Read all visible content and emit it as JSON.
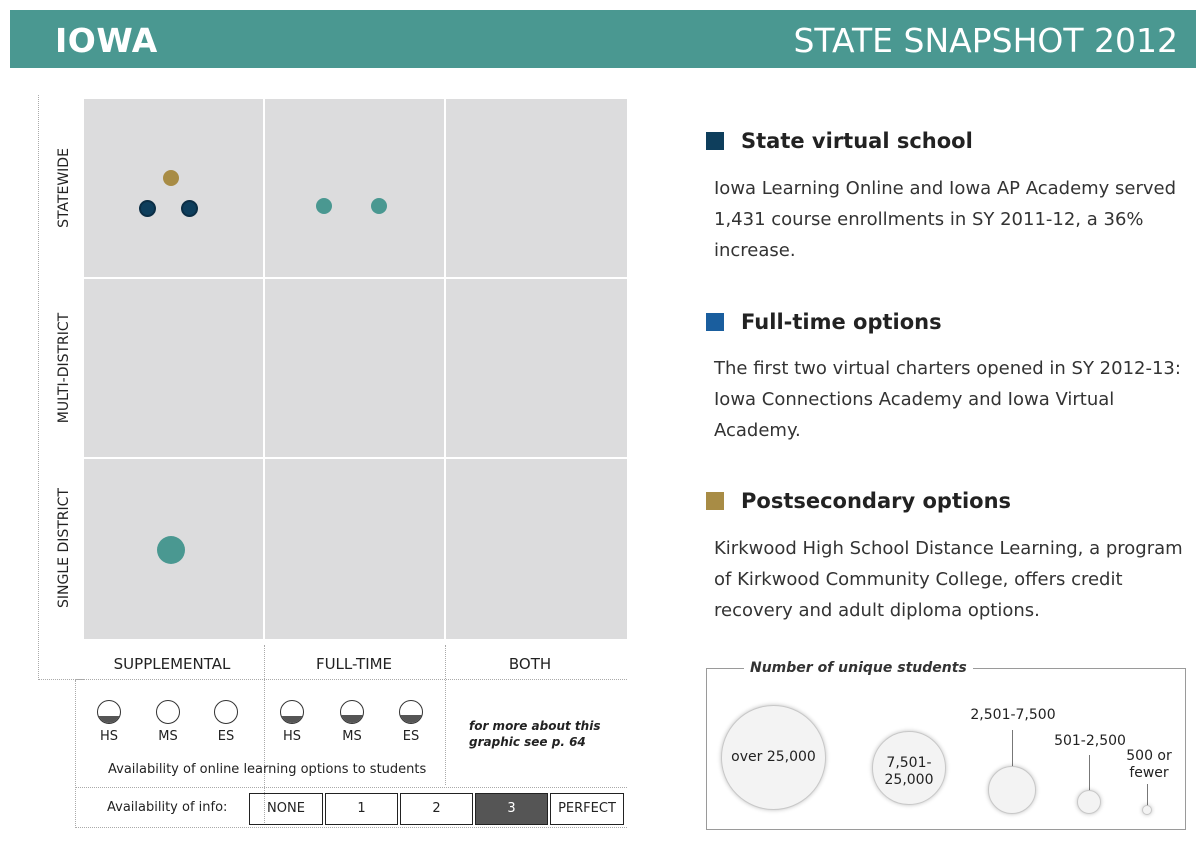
{
  "header": {
    "state": "IOWA",
    "title": "STATE SNAPSHOT 2012"
  },
  "colors": {
    "header_bg": "#4a9891",
    "state_virtual_school": "#0e3e5c",
    "full_time": "#1a5e9e",
    "postsecondary": "#a88c45",
    "teal_dot": "#4a9891"
  },
  "grid": {
    "rows": [
      "STATEWIDE",
      "MULTI-DISTRICT",
      "SINGLE DISTRICT"
    ],
    "columns": [
      "SUPPLEMENTAL",
      "FULL-TIME",
      "BOTH"
    ]
  },
  "availability": {
    "levels": [
      "HS",
      "MS",
      "ES",
      "HS",
      "MS",
      "ES"
    ],
    "fill_fraction": [
      0.3,
      0.0,
      0.0,
      0.3,
      0.35,
      0.35
    ],
    "caption": "Availability of online learning options to students",
    "more_info": "for more about this graphic see p. 64",
    "info_label": "Availability of info:",
    "info_options": [
      "NONE",
      "1",
      "2",
      "3",
      "PERFECT"
    ],
    "info_selected": "3"
  },
  "sections": [
    {
      "title": "State virtual school",
      "body": "Iowa Learning Online and Iowa AP Academy served 1,431 course enrollments in SY 2011-12, a 36% increase."
    },
    {
      "title": "Full-time options",
      "body": "The first two virtual charters opened in SY 2012-13: Iowa Connections Academy and Iowa Virtual Academy."
    },
    {
      "title": "Postsecondary options",
      "body": "Kirkwood High School Distance Learning, a program of Kirkwood Community College, offers credit recovery and adult diploma options."
    }
  ],
  "legend": {
    "title": "Number of unique students",
    "sizes": [
      "over 25,000",
      "7,501-25,000",
      "2,501-7,500",
      "501-2,500",
      "500 or fewer"
    ],
    "size_line1": [
      "over 25,000",
      "7,501-",
      "2,501-7,500",
      "501-2,500",
      "500 or"
    ],
    "size_line2": [
      "",
      "25,000",
      "",
      "",
      "fewer"
    ]
  }
}
